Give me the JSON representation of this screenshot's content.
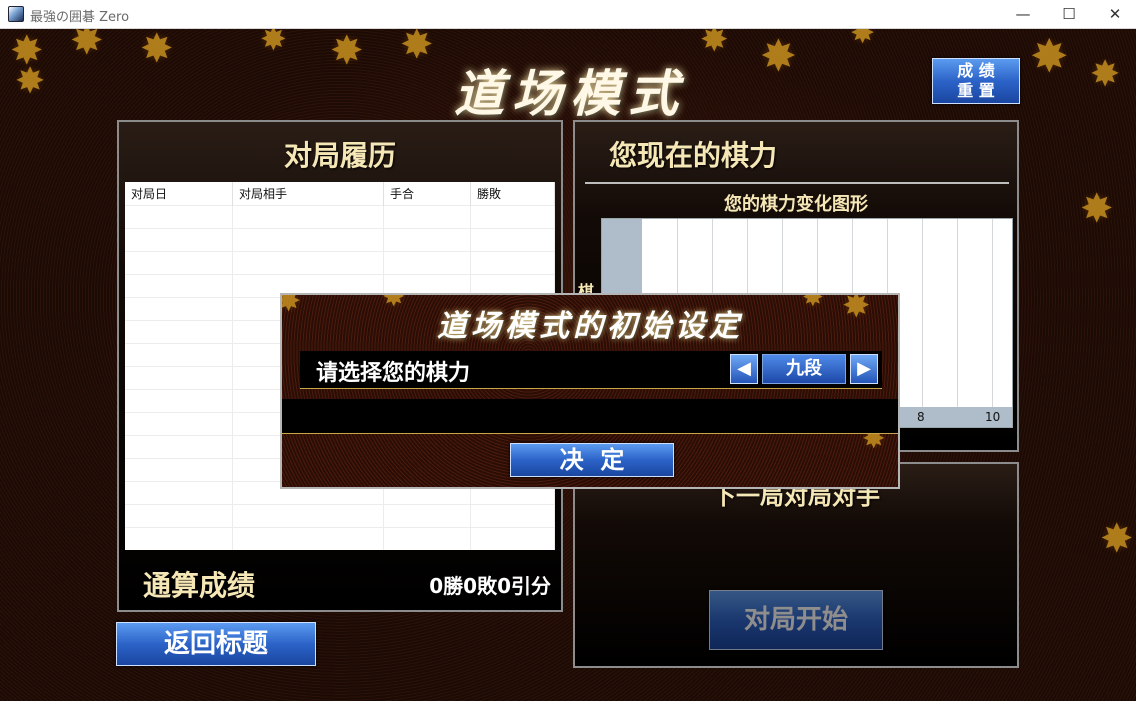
{
  "window": {
    "title": "最強の囲碁 Zero",
    "minimize": "—",
    "maximize": "☐",
    "close": "✕"
  },
  "screen_title": "道场模式",
  "reset_button": {
    "line1": "成 绩",
    "line2": "重 置"
  },
  "history_panel": {
    "title": "对局履历",
    "columns": [
      "对局日",
      "对局相手",
      "手合",
      "勝敗"
    ],
    "rows": [],
    "summary_label": "通算成绩",
    "summary_value": "0勝0敗0引分"
  },
  "strength_panel": {
    "title": "您现在的棋力",
    "graph_title": "您的棋力变化图形",
    "y_label": "棋",
    "x_ticks": [
      "8",
      "10"
    ]
  },
  "opponent_panel": {
    "title_partial": "下一局对局对手",
    "start_button": "对局开始"
  },
  "back_button": "返回标题",
  "dialog": {
    "title": "道场模式的初始设定",
    "prompt": "请选择您的棋力",
    "selected_rank": "九段",
    "prev_icon": "◀",
    "next_icon": "▶",
    "confirm_button": "决  定"
  },
  "colors": {
    "gold_text": "#f6e7b6",
    "button_blue": "#2c63c8",
    "background": "#1e0b06"
  }
}
